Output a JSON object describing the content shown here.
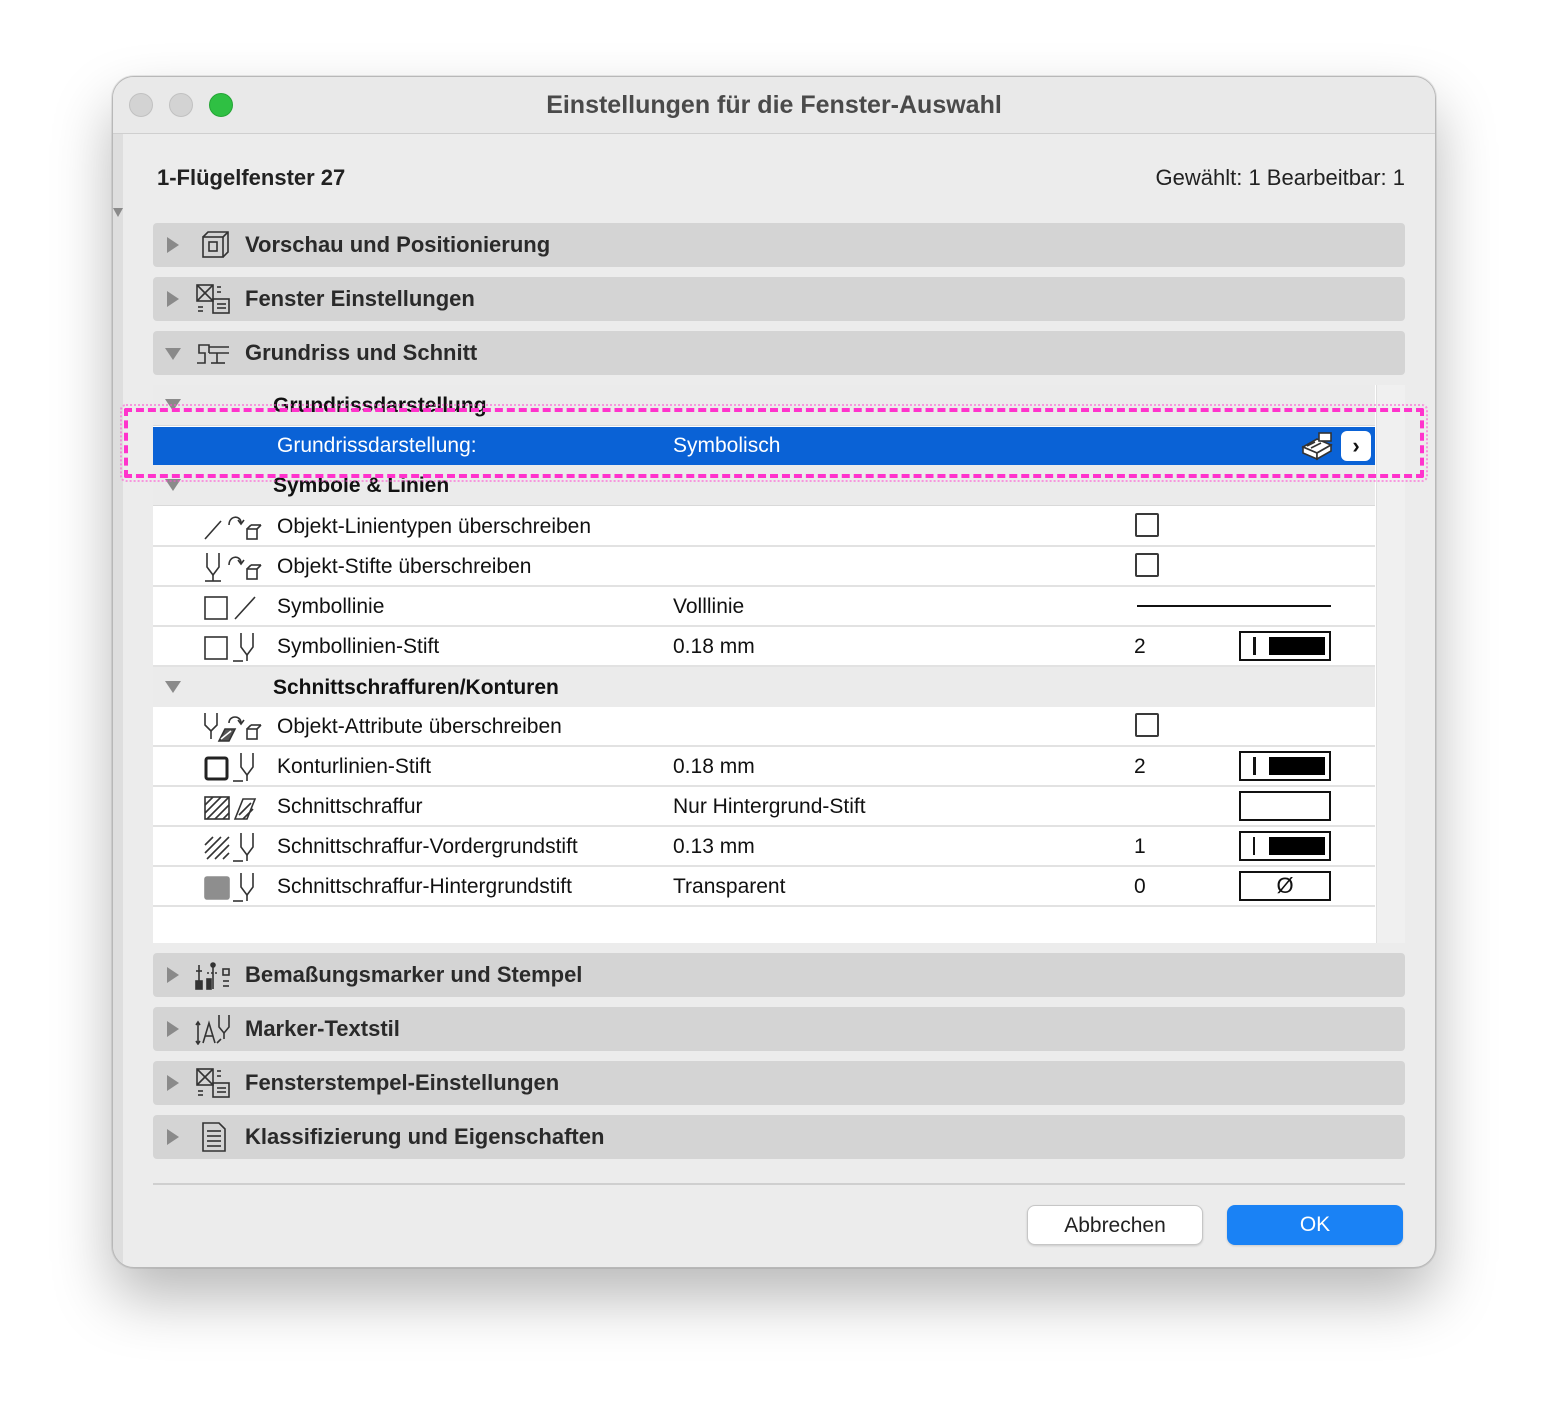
{
  "window": {
    "title": "Einstellungen für die Fenster-Auswahl"
  },
  "header": {
    "name": "1-Flügelfenster 27",
    "selection": "Gewählt: 1 Bearbeitbar: 1"
  },
  "panels": [
    {
      "label": "Vorschau und Positionierung",
      "icon": "preview-box-icon",
      "expanded": false
    },
    {
      "label": "Fenster Einstellungen",
      "icon": "window-settings-icon",
      "expanded": false
    },
    {
      "label": "Grundriss und Schnitt",
      "icon": "floorplan-section-icon",
      "expanded": true
    },
    {
      "label": "Bemaßungsmarker und Stempel",
      "icon": "dimension-marker-icon",
      "expanded": false
    },
    {
      "label": "Marker-Textstil",
      "icon": "marker-text-style-icon",
      "expanded": false
    },
    {
      "label": "Fensterstempel-Einstellungen",
      "icon": "window-stamp-icon",
      "expanded": false
    },
    {
      "label": "Klassifizierung und Eigenschaften",
      "icon": "classification-icon",
      "expanded": false
    }
  ],
  "floorplan": {
    "sections": {
      "display": "Grundrissdarstellung",
      "symbols": "Symbole & Linien",
      "cut_fills": "Schnittschraffuren/Konturen"
    },
    "highlight_row": {
      "label": "Grundrissdarstellung:",
      "value": "Symbolisch",
      "icon": "floorplan-display-icon",
      "button_glyph": "›"
    },
    "symbol_rows": [
      {
        "label": "Objekt-Linientypen überschreiben",
        "icon": "override-linetype-icon",
        "checkbox": false
      },
      {
        "label": "Objekt-Stifte überschreiben",
        "icon": "override-pen-icon",
        "checkbox": false
      },
      {
        "label": "Symbollinie",
        "value": "Volllinie",
        "icon": "symbol-line-icon"
      },
      {
        "label": "Symbollinien-Stift",
        "value": "0.18 mm",
        "number": "2",
        "icon": "symbol-line-pen-icon"
      }
    ],
    "cut_rows": [
      {
        "label": "Objekt-Attribute überschreiben",
        "icon": "override-attributes-icon",
        "checkbox": false
      },
      {
        "label": "Konturlinien-Stift",
        "value": "0.18 mm",
        "number": "2",
        "icon": "contour-pen-icon"
      },
      {
        "label": "Schnittschraffur",
        "value": "Nur Hintergrund-Stift",
        "icon": "cut-fill-icon"
      },
      {
        "label": "Schnittschraffur-Vordergrundstift",
        "value": "0.13 mm",
        "number": "1",
        "icon": "cut-fill-fg-pen-icon"
      },
      {
        "label": "Schnittschraffur-Hintergrundstift",
        "value": "Transparent",
        "number": "0",
        "icon": "cut-fill-bg-pen-icon",
        "swatch_glyph": "Ø"
      }
    ]
  },
  "buttons": {
    "cancel": "Abbrechen",
    "ok": "OK"
  },
  "colors": {
    "selection": "#0a62d6",
    "ok_button": "#1a82f5",
    "annotation_highlight": "#ff33cc",
    "traffic_green": "#2fc043"
  }
}
